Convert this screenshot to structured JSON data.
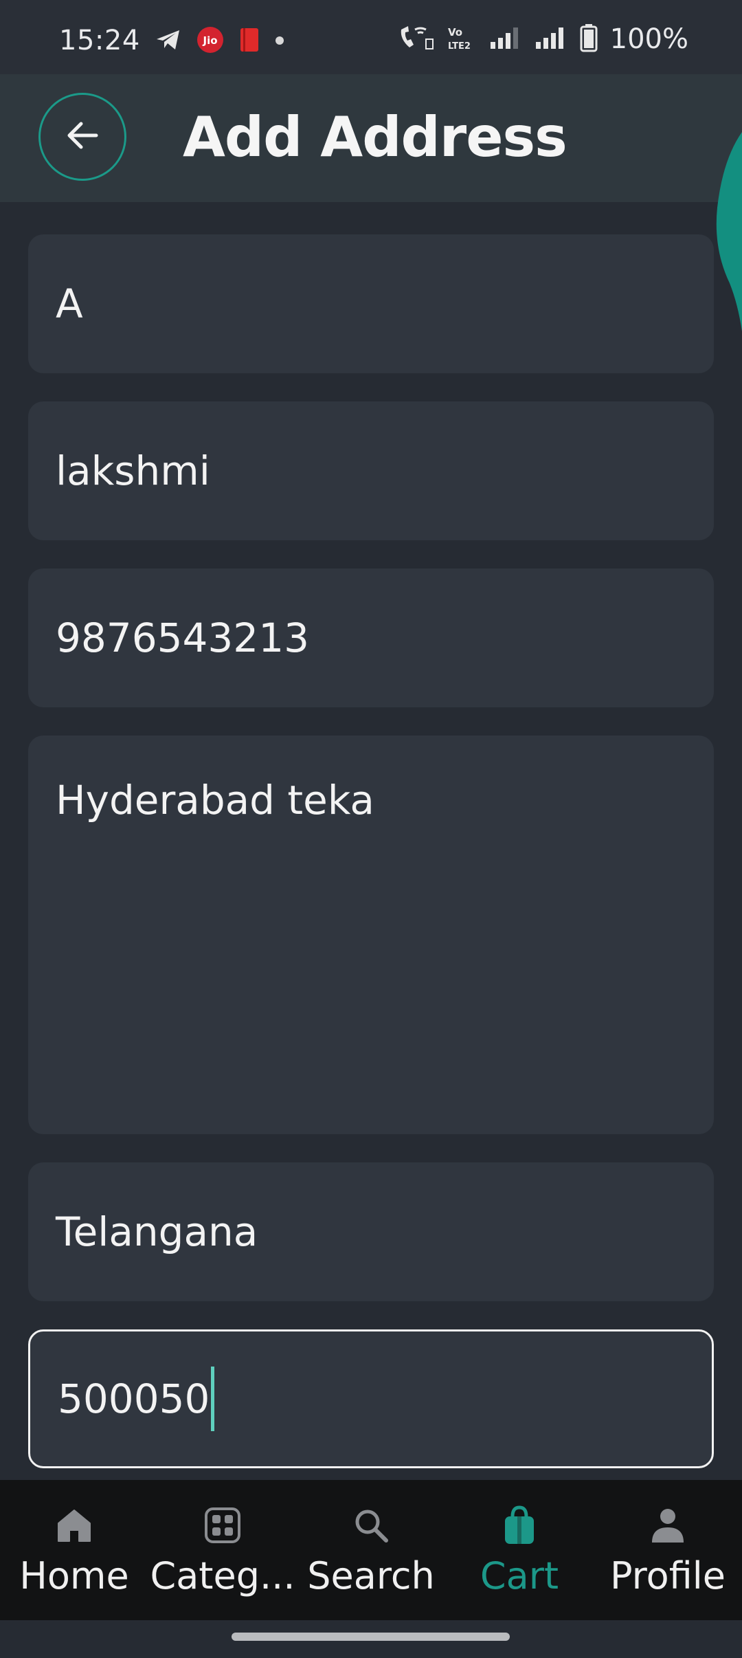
{
  "status_bar": {
    "time": "15:24",
    "battery": "100%",
    "left_icons": [
      "telegram-icon",
      "jio-icon",
      "red-app-icon",
      "dot-icon"
    ],
    "right_icons": [
      "wifi-call-icon",
      "volte-icon",
      "signal-icon",
      "signal-icon",
      "battery-icon"
    ]
  },
  "header": {
    "title": "Add Address",
    "back_icon": "arrow-left-icon",
    "accent_color": "#1b9a89"
  },
  "form": {
    "fields": [
      {
        "value": "A"
      },
      {
        "value": "lakshmi"
      },
      {
        "value": "9876543213"
      },
      {
        "value": "Hyderabad teka"
      },
      {
        "value": "Telangana"
      },
      {
        "value": "500050"
      }
    ]
  },
  "bottom_nav": {
    "items": [
      {
        "label": "Home",
        "icon": "home-icon"
      },
      {
        "label": "Categ...",
        "icon": "categories-icon"
      },
      {
        "label": "Search",
        "icon": "search-icon"
      },
      {
        "label": "Cart",
        "icon": "cart-icon",
        "active": true
      },
      {
        "label": "Profile",
        "icon": "profile-icon"
      }
    ],
    "active_color": "#1c9889"
  }
}
